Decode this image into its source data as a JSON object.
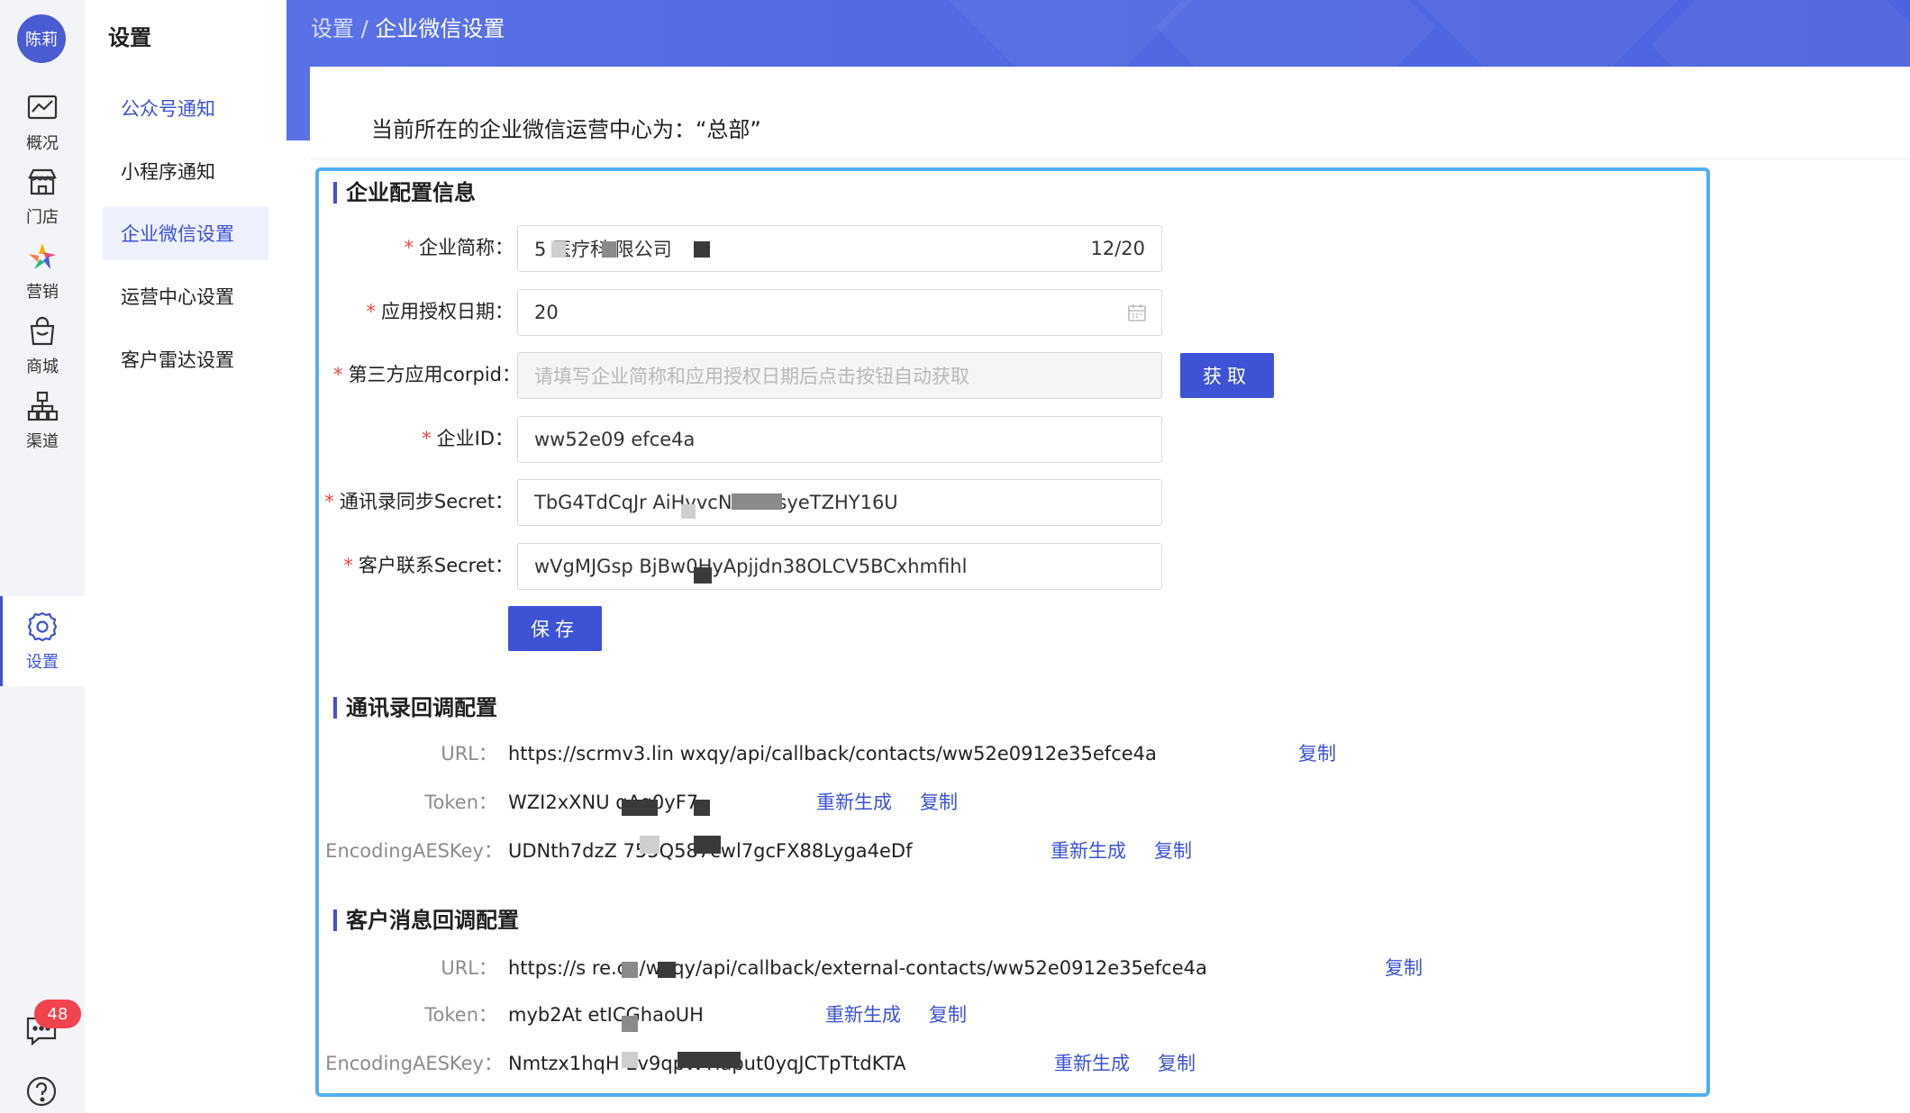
{
  "user": {
    "avatar_text": "陈莉"
  },
  "rail": {
    "items": [
      {
        "label": "概况",
        "icon": "chart-icon"
      },
      {
        "label": "门店",
        "icon": "store-icon"
      },
      {
        "label": "营销",
        "icon": "marketing-icon"
      },
      {
        "label": "商城",
        "icon": "shopping-bag-icon"
      },
      {
        "label": "渠道",
        "icon": "channel-icon"
      },
      {
        "label": "设置",
        "icon": "gear-icon",
        "active": true
      }
    ],
    "message_badge": "48"
  },
  "submenu": {
    "title": "设置",
    "items": [
      {
        "label": "公众号通知"
      },
      {
        "label": "小程序通知"
      },
      {
        "label": "企业微信设置",
        "active": true
      },
      {
        "label": "运营中心设置"
      },
      {
        "label": "客户雷达设置"
      }
    ]
  },
  "breadcrumb": {
    "parent": "设置",
    "separator": " / ",
    "current": "企业微信设置"
  },
  "center_text": "当前所在的企业微信运营中心为：“总部”",
  "config": {
    "title": "企业配置信息",
    "fields": {
      "short_name": {
        "label": "企业简称：",
        "value": "5        医疗科       限公司",
        "count": "12/20"
      },
      "auth_date": {
        "label": "应用授权日期：",
        "value": "20"
      },
      "corpid": {
        "label": "第三方应用corpid：",
        "placeholder": "请填写企业简称和应用授权日期后点击按钮自动获取",
        "button": "获取"
      },
      "corp_id": {
        "label": "企业ID：",
        "value": "ww52e09          efce4a"
      },
      "contacts_secret": {
        "label": "通讯录同步Secret：",
        "value": "TbG4TdCqJr                   AiHvvcN-RZ5syeTZHY16U"
      },
      "customer_secret": {
        "label": "客户联系Secret：",
        "value": "wVgMJGsp            BjBw0HyApjjdn38OLCV5BCxhmfihl"
      }
    },
    "save_button": "保存"
  },
  "contacts_callback": {
    "title": "通讯录回调配置",
    "url_label": "URL：",
    "url_value": "https://scrmv3.lin                    wxqy/api/callback/contacts/ww52e0912e35efce4a",
    "token_label": "Token：",
    "token_value": "WZI2xXNU             qAq0yF7",
    "aes_label": "EncodingAESKey：",
    "aes_value": "UDNth7dzZ                 755Q587cwl7gcFX88Lyga4eDf",
    "regen": "重新生成",
    "copy": "复制"
  },
  "customer_callback": {
    "title": "客户消息回调配置",
    "url_label": "URL：",
    "url_value": "https://s                                 re.cn/wxqy/api/callback/external-contacts/ww52e0912e35efce4a",
    "token_label": "Token：",
    "token_value": "myb2At                    etICGhaoUH",
    "aes_label": "EncodingAESKey：",
    "aes_value": "Nmtzx1hqH                    Ev9qpWYlaput0yqJCTpTtdKTA",
    "regen": "重新生成",
    "copy": "复制"
  },
  "colors": {
    "primary": "#3d52d5",
    "header_band": "#5068e2",
    "panel_border": "#4fb0f4",
    "required": "#f04444"
  }
}
